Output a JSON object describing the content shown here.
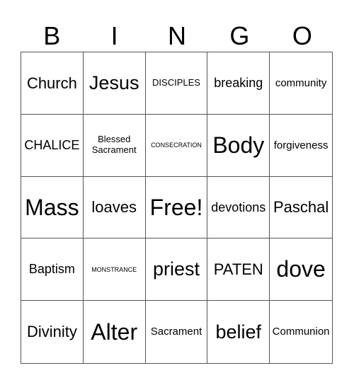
{
  "header": [
    "B",
    "I",
    "N",
    "G",
    "O"
  ],
  "cells": [
    {
      "text": "Church",
      "size": "xl"
    },
    {
      "text": "Jesus",
      "size": "xxl"
    },
    {
      "text": "DISCIPLES",
      "size": "s"
    },
    {
      "text": "breaking",
      "size": "l"
    },
    {
      "text": "community",
      "size": "m"
    },
    {
      "text": "CHALICE",
      "size": "l"
    },
    {
      "text": "Blessed Sacrament",
      "size": "s"
    },
    {
      "text": "CONSECRATION",
      "size": "xs"
    },
    {
      "text": "Body",
      "size": "xxxl"
    },
    {
      "text": "forgiveness",
      "size": "m"
    },
    {
      "text": "Mass",
      "size": "xxxl"
    },
    {
      "text": "loaves",
      "size": "xl"
    },
    {
      "text": "Free!",
      "size": "xxxl"
    },
    {
      "text": "devotions",
      "size": "l"
    },
    {
      "text": "Paschal",
      "size": "xl"
    },
    {
      "text": "Baptism",
      "size": "l"
    },
    {
      "text": "MONSTRANCE",
      "size": "xs"
    },
    {
      "text": "priest",
      "size": "xxl"
    },
    {
      "text": "PATEN",
      "size": "xl"
    },
    {
      "text": "dove",
      "size": "xxxl"
    },
    {
      "text": "Divinity",
      "size": "xl"
    },
    {
      "text": "Alter",
      "size": "xxxl"
    },
    {
      "text": "Sacrament",
      "size": "m"
    },
    {
      "text": "belief",
      "size": "xxl"
    },
    {
      "text": "Communion",
      "size": "m"
    }
  ]
}
